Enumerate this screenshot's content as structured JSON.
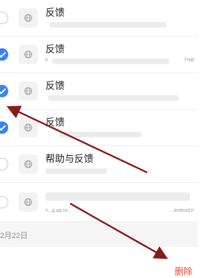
{
  "list": {
    "items": [
      {
        "title": "反馈",
        "subtitle": "",
        "subtitle_right": "",
        "checked": false
      },
      {
        "title": "反馈",
        "subtitle": "h",
        "subtitle_right": "7%B",
        "checked": true
      },
      {
        "title": "反馈",
        "subtitle": "",
        "subtitle_right": "",
        "checked": true
      },
      {
        "title": "反馈",
        "subtitle": "",
        "subtitle_right": "",
        "checked": true
      },
      {
        "title": "帮助与反馈",
        "subtitle": "",
        "subtitle_right": "",
        "checked": false
      },
      {
        "title": "",
        "subtitle": "h...g.qq.co",
        "subtitle_right": "...android.h",
        "checked": false
      }
    ]
  },
  "section": {
    "date": "2月22日"
  },
  "footer": {
    "delete_label": "删除"
  },
  "colors": {
    "accent": "#3b82f6",
    "danger": "#e64a3b",
    "annotation_arrow": "#8b1a1a"
  },
  "icons": {
    "thumb": "globe-icon"
  }
}
